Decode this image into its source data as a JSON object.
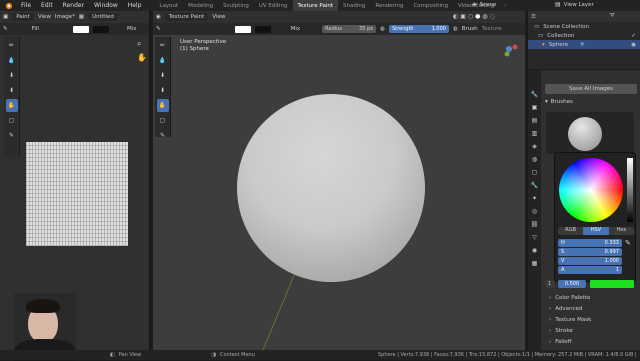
{
  "menu": {
    "file": "File",
    "edit": "Edit",
    "render": "Render",
    "window": "Window",
    "help": "Help"
  },
  "workspaces": [
    "Layout",
    "Modeling",
    "Sculpting",
    "UV Editing",
    "Texture Paint",
    "Shading",
    "Rendering",
    "Compositing",
    "Video Editing"
  ],
  "scene": "Scene",
  "view_layer": "View Layer",
  "image_editor": {
    "mode": "Paint",
    "view": "View",
    "image_menu": "Image*",
    "image_name": "Untitled",
    "fill_label": "Fill",
    "blend": "Mix"
  },
  "viewport": {
    "mode": "Texture Paint",
    "view": "View",
    "blend": "Mix",
    "radius_label": "Radius",
    "radius_value": "35 px",
    "strength_label": "Strength",
    "strength_value": "1.000",
    "brush_menu": "Brush",
    "texture_menu": "Texture",
    "perspective": "User Perspective",
    "object": "(1) Sphere"
  },
  "outliner": {
    "collection_root": "Scene Collection",
    "collection": "Collection",
    "object": "Sphere"
  },
  "properties": {
    "save_all": "Save All Images",
    "brushes": "Brushes",
    "color_modes": [
      "RGB",
      "HSV",
      "Hex"
    ],
    "active_mode": "HSV",
    "h_label": "H",
    "h_value": "0.333",
    "s_label": "S",
    "s_value": "0.997",
    "v_label": "V",
    "v_value": "1.000",
    "a_label": "A",
    "a_value": "1",
    "slot_index": "1",
    "slot_value": "0.500",
    "active_color": "#1fe01f",
    "sections": [
      "Color Palette",
      "Advanced",
      "Texture Mask",
      "Stroke",
      "Falloff"
    ]
  },
  "statusbar": {
    "pan": "Pan View",
    "context": "Context Menu",
    "stats": "Sphere | Verts:7,938 | Faces:7,936 | Tris:15,872 | Objects:1/1 | Memory: 257.2 MiB | VRAM: 1.4/8.0 GiB | 3.1"
  },
  "colors": {
    "accent": "#4772b3",
    "viewport_bg": "#3d3d3d",
    "sphere": "#c8c8c8"
  }
}
